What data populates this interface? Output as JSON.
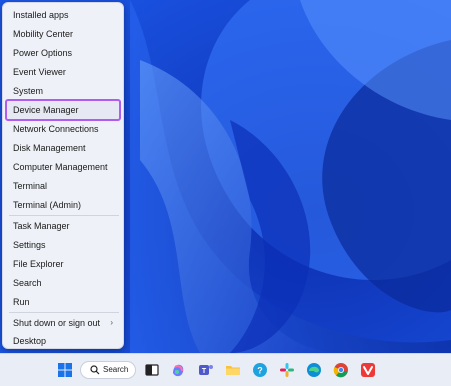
{
  "menu": {
    "items": [
      {
        "label": "Installed apps"
      },
      {
        "label": "Mobility Center"
      },
      {
        "label": "Power Options"
      },
      {
        "label": "Event Viewer"
      },
      {
        "label": "System"
      },
      {
        "label": "Device Manager"
      },
      {
        "label": "Network Connections"
      },
      {
        "label": "Disk Management"
      },
      {
        "label": "Computer Management"
      },
      {
        "label": "Terminal"
      },
      {
        "label": "Terminal (Admin)"
      },
      {
        "label": "Task Manager"
      },
      {
        "label": "Settings"
      },
      {
        "label": "File Explorer"
      },
      {
        "label": "Search"
      },
      {
        "label": "Run"
      },
      {
        "label": "Shut down or sign out"
      },
      {
        "label": "Desktop"
      }
    ],
    "highlight_color": "#b05cf0"
  },
  "taskbar": {
    "search_label": "Search",
    "icons": [
      "windows-start-icon",
      "search-icon",
      "task-view-icon",
      "copilot-icon",
      "teams-icon",
      "file-explorer-icon",
      "help-icon",
      "slack-icon",
      "edge-icon",
      "chrome-icon",
      "vivaldi-icon"
    ]
  }
}
